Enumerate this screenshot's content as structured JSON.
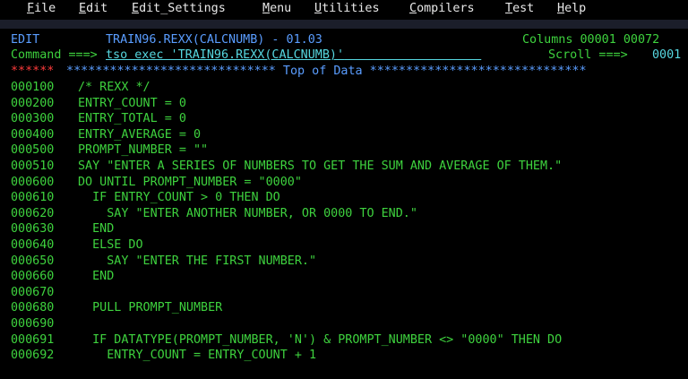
{
  "menu": [
    {
      "label": "File",
      "u": "F",
      "rest": "ile"
    },
    {
      "label": "Edit",
      "u": "E",
      "rest": "dit"
    },
    {
      "label": "Edit_Settings",
      "u": "E",
      "rest": "dit_Settings"
    },
    {
      "label": "Menu",
      "u": "M",
      "rest": "enu"
    },
    {
      "label": "Utilities",
      "u": "U",
      "rest": "tilities"
    },
    {
      "label": "Compilers",
      "u": "C",
      "rest": "ompilers"
    },
    {
      "label": "Test",
      "u": "T",
      "rest": "est"
    },
    {
      "label": "Help",
      "u": "H",
      "rest": "elp"
    }
  ],
  "header": {
    "mode": "EDIT",
    "dataset": "TRAIN96.REXX(CALCNUMB) - 01.03",
    "columns": "Columns 00001 00072",
    "command_label": "Command ===>",
    "command_value": "tso exec 'TRAIN96.REXX(CALCNUMB)'",
    "scroll_label": "Scroll ===>",
    "scroll_value": "0001"
  },
  "top_of_data": {
    "marker": "******",
    "text": " ***************************** Top of Data ******************************"
  },
  "lines": [
    {
      "num": "000100",
      "code": "/* REXX */"
    },
    {
      "num": "000200",
      "code": "ENTRY_COUNT = 0"
    },
    {
      "num": "000300",
      "code": "ENTRY_TOTAL = 0"
    },
    {
      "num": "000400",
      "code": "ENTRY_AVERAGE = 0"
    },
    {
      "num": "000500",
      "code": "PROMPT_NUMBER = \"\""
    },
    {
      "num": "000510",
      "code": "SAY \"ENTER A SERIES OF NUMBERS TO GET THE SUM AND AVERAGE OF THEM.\""
    },
    {
      "num": "000600",
      "code": "DO UNTIL PROMPT_NUMBER = \"0000\""
    },
    {
      "num": "000610",
      "code": "  IF ENTRY_COUNT > 0 THEN DO"
    },
    {
      "num": "000620",
      "code": "    SAY \"ENTER ANOTHER NUMBER, OR 0000 TO END.\""
    },
    {
      "num": "000630",
      "code": "  END"
    },
    {
      "num": "000640",
      "code": "  ELSE DO"
    },
    {
      "num": "000650",
      "code": "    SAY \"ENTER THE FIRST NUMBER.\""
    },
    {
      "num": "000660",
      "code": "  END"
    },
    {
      "num": "000670",
      "code": ""
    },
    {
      "num": "000680",
      "code": "  PULL PROMPT_NUMBER"
    },
    {
      "num": "000690",
      "code": ""
    },
    {
      "num": "000691",
      "code": "  IF DATATYPE(PROMPT_NUMBER, 'N') & PROMPT_NUMBER <> \"0000\" THEN DO"
    },
    {
      "num": "000692",
      "code": "    ENTRY_COUNT = ENTRY_COUNT + 1"
    }
  ]
}
